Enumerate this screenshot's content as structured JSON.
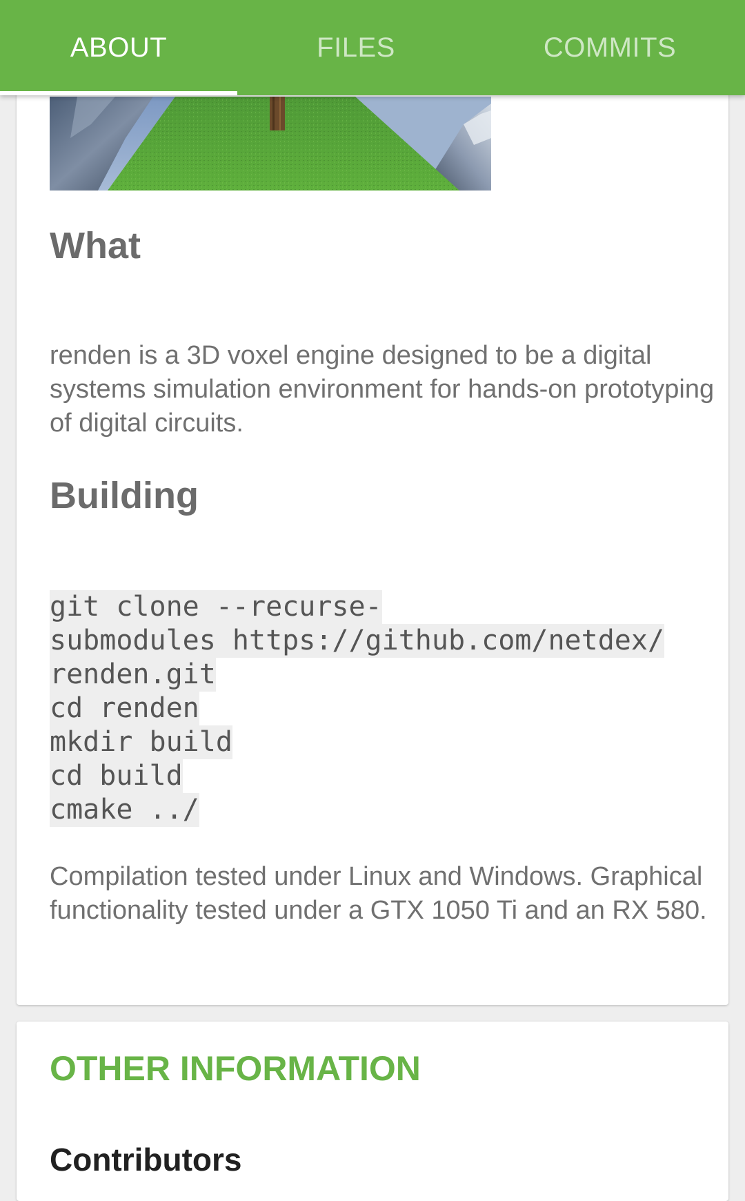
{
  "tabs": [
    {
      "label": "ABOUT",
      "active": true
    },
    {
      "label": "FILES",
      "active": false
    },
    {
      "label": "COMMITS",
      "active": false
    }
  ],
  "colors": {
    "accent": "#68b447",
    "heading": "#6b6b6b",
    "body_text": "#707070",
    "code_background": "#eeeeee"
  },
  "about": {
    "hero_image": "voxel-landscape-screenshot",
    "what_heading": "What",
    "what_text": "renden is a 3D voxel engine designed to be a digital systems simulation environment for hands-on prototyping of digital circuits.",
    "building_heading": "Building",
    "code_lines": [
      "git clone --recurse-",
      "submodules https://github.com/netdex/",
      "renden.git",
      "cd renden",
      "mkdir build",
      "cd build",
      "cmake ../"
    ],
    "compile_text": "Compilation tested under Linux and Windows. Graphical functionality tested under a GTX 1050 Ti and an RX 580."
  },
  "other": {
    "title": "OTHER INFORMATION",
    "contributors_heading": "Contributors"
  }
}
